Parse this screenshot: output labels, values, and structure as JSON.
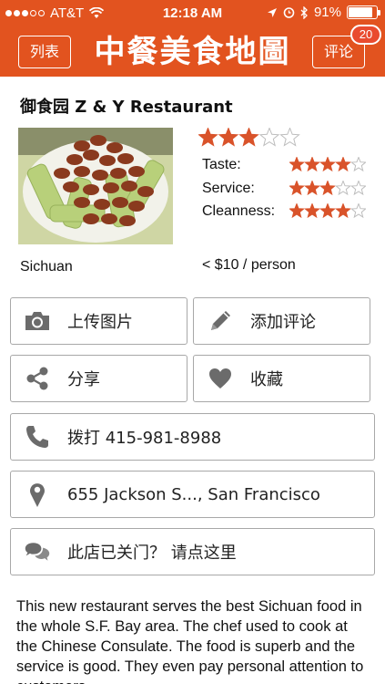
{
  "status_bar": {
    "carrier": "AT&T",
    "time": "12:18 AM",
    "battery_percent": "91%",
    "signal_bars_filled": 3,
    "signal_bars_total": 5
  },
  "nav": {
    "left_label": "列表",
    "title": "中餐美食地圖",
    "right_label": "评论",
    "badge": "20"
  },
  "restaurant": {
    "name": "御食园 Z & Y Restaurant",
    "photo_caption": "",
    "overall_rating": 3,
    "ratings": [
      {
        "label": "Taste:",
        "stars": 4
      },
      {
        "label": "Service:",
        "stars": 3
      },
      {
        "label": "Cleanness:",
        "stars": 4
      }
    ],
    "cuisine": "Sichuan",
    "price": "< $10 / person"
  },
  "actions": {
    "upload_photo": "上传图片",
    "add_review": "添加评论",
    "share": "分享",
    "favorite": "收藏",
    "call": "拨打 415-981-8988",
    "address": "655 Jackson S..., San Francisco",
    "report_closed": "此店已关门？ 请点这里"
  },
  "description": "This new restaurant serves the best Sichuan food in the whole S.F. Bay area. The chef used to cook at the Chinese Consulate. The food is superb and the service is good. They even pay personal attention to customers",
  "colors": {
    "brand": "#e2531f",
    "star": "#d9532a",
    "icon_gray": "#6b6b6b"
  }
}
